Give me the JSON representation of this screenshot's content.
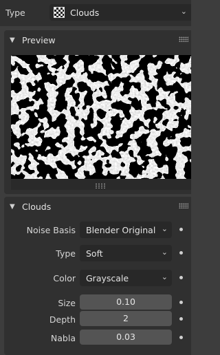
{
  "top": {
    "type_label": "Type",
    "texture_type": "Clouds"
  },
  "preview": {
    "title": "Preview"
  },
  "clouds": {
    "title": "Clouds",
    "noise_basis_label": "Noise Basis",
    "noise_basis_value": "Blender Original",
    "type_label": "Type",
    "type_value": "Soft",
    "color_label": "Color",
    "color_value": "Grayscale",
    "size_label": "Size",
    "size_value": "0.10",
    "depth_label": "Depth",
    "depth_value": "2",
    "nabla_label": "Nabla",
    "nabla_value": "0.03"
  },
  "colors": {
    "background": "#3d3d3d",
    "panel": "#303030",
    "dropdown": "#282828",
    "number_field": "#545454"
  },
  "icons": {
    "texture_type": "checkerboard-icon",
    "collapse": "chevron-down-icon",
    "drag": "grip-icon"
  }
}
